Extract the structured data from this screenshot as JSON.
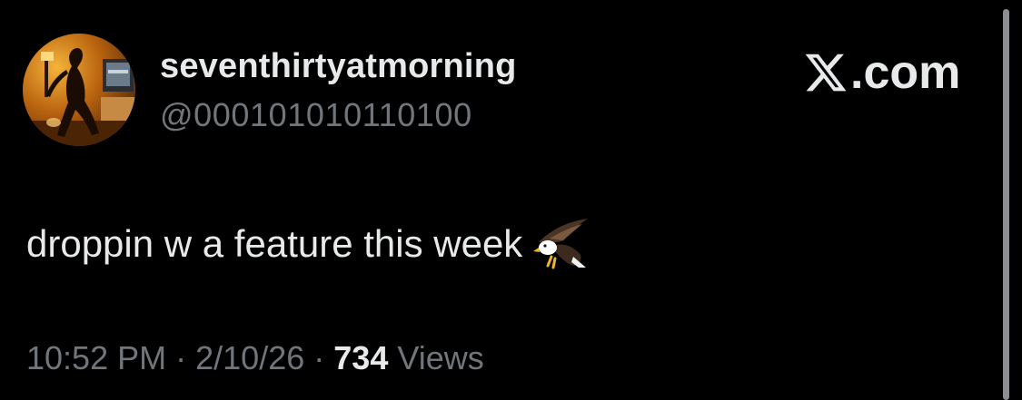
{
  "author": {
    "display_name": "seventhirtyatmorning",
    "handle": "@000101010110100",
    "avatar_icon": "avatar-silhouette-photo"
  },
  "brand": {
    "logo_icon": "x-logo-icon",
    "domain_suffix": ".com"
  },
  "post": {
    "text": "droppin w a feature this week",
    "emoji_icon": "eagle-emoji-icon"
  },
  "meta": {
    "time": "10:52 PM",
    "separator": "·",
    "date": "2/10/26",
    "views_count": "734",
    "views_label": "Views"
  },
  "colors": {
    "background": "#000000",
    "primary_text": "#e7e9ea",
    "secondary_text": "#71767b"
  }
}
